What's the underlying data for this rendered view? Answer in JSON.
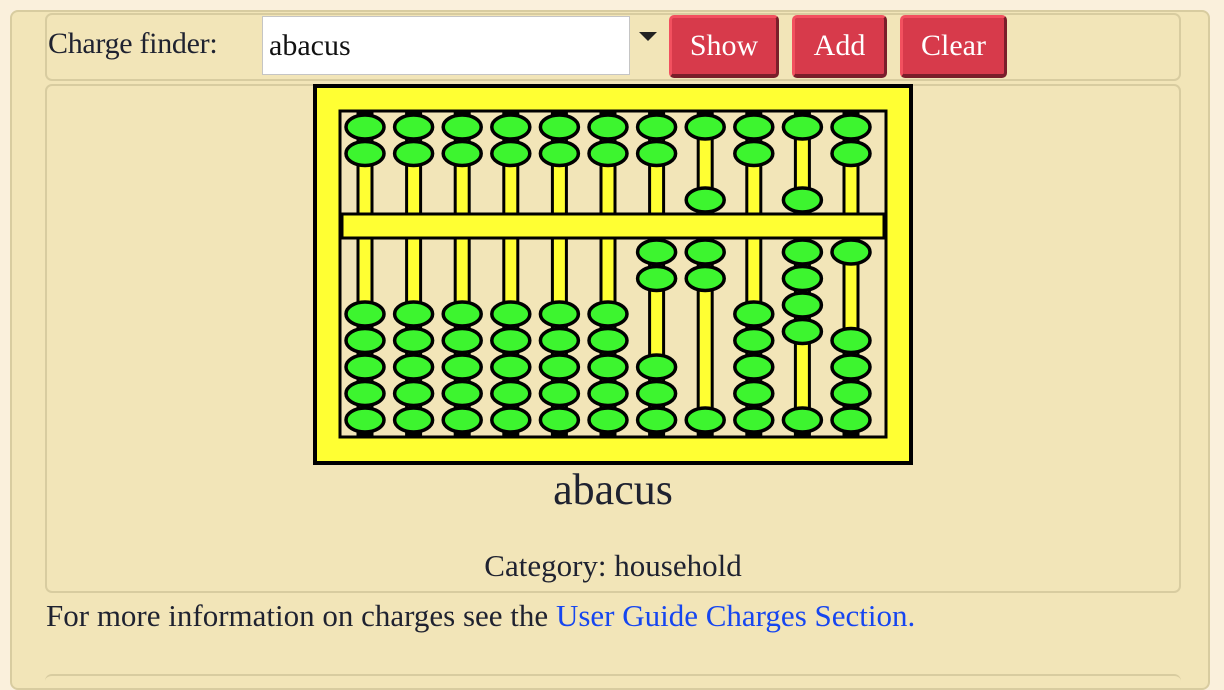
{
  "finder": {
    "label": "Charge finder:",
    "input_value": "abacus",
    "dropdown_icon": "caret-down-icon"
  },
  "buttons": {
    "show": "Show",
    "add": "Add",
    "clear": "Clear"
  },
  "colors": {
    "page_bg": "#faf0dc",
    "panel_bg": "#f2e5b8",
    "panel_border": "#d8cca0",
    "button_bg": "#d73a4b",
    "link": "#1646f0",
    "abacus_frame": "#ffff33",
    "abacus_bead": "#3df52f"
  },
  "charge": {
    "name": "abacus",
    "category_label": "Category:",
    "category": "household",
    "image_alt": "abacus"
  },
  "footer": {
    "text": "For more information on charges see the ",
    "link_text": "User Guide Charges Section."
  }
}
